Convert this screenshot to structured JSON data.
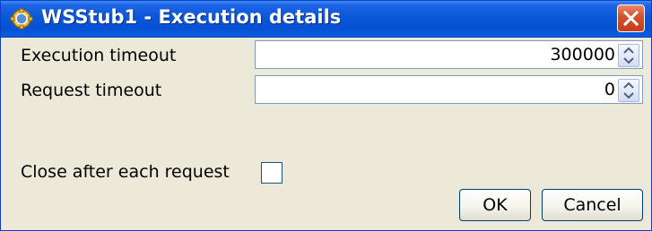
{
  "window": {
    "title": "WSStub1 - Execution details",
    "icon": "app-icon",
    "close_icon": "close-icon"
  },
  "fields": {
    "execution_timeout": {
      "label": "Execution timeout",
      "value": "300000"
    },
    "request_timeout": {
      "label": "Request timeout",
      "value": "0"
    },
    "close_after_each_request": {
      "label": "Close after each request",
      "checked": false
    }
  },
  "buttons": {
    "ok_label": "OK",
    "cancel_label": "Cancel"
  },
  "colors": {
    "titlebar": "#0750d4",
    "dialog_background": "#ece9d8",
    "close_button": "#d5542f",
    "input_border": "#7f9db9"
  }
}
